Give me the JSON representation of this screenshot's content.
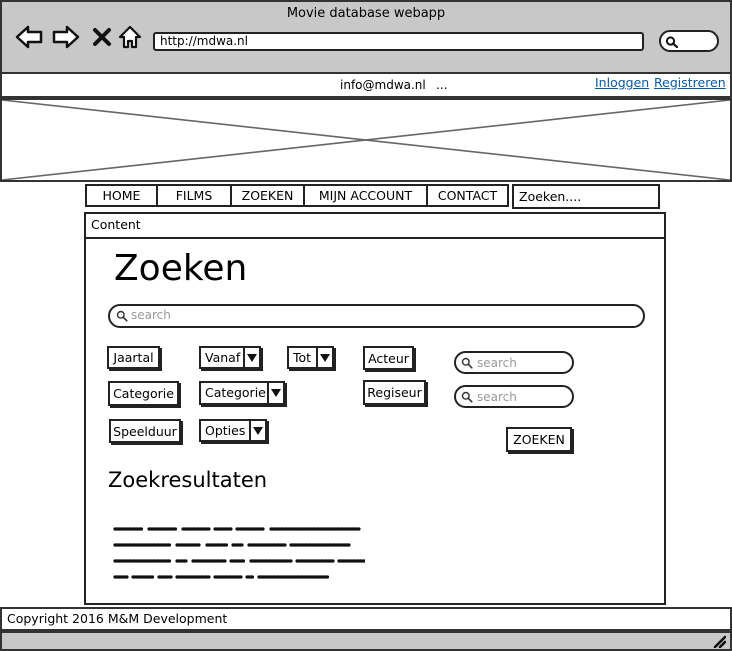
{
  "window": {
    "title": "Movie database webapp"
  },
  "browser": {
    "url": "http://mdwa.nl",
    "icons": [
      "back-arrow-icon",
      "forward-arrow-icon",
      "close-icon",
      "home-icon",
      "search-icon"
    ]
  },
  "topbar": {
    "email": "info@mdwa.nl",
    "dots": "...",
    "login_label": "Inloggen",
    "register_label": "Registreren",
    "link_color": "#0a5aa8"
  },
  "nav": {
    "items": [
      {
        "label": "HOME"
      },
      {
        "label": "FILMS"
      },
      {
        "label": "ZOEKEN"
      },
      {
        "label": "MIJN ACCOUNT"
      },
      {
        "label": "CONTACT"
      }
    ],
    "search_placeholder": "Zoeken...."
  },
  "content": {
    "label": "Content",
    "title": "Zoeken",
    "search_placeholder": "search",
    "filters": {
      "jaartal": "Jaartal",
      "vanaf": "Vanaf",
      "tot": "Tot",
      "acteur": "Acteur",
      "acteur_placeholder": "search",
      "categorie_button": "Categorie",
      "categorie_select": "Categorie",
      "regisseur": "Regiseur",
      "regisseur_placeholder": "search",
      "speelduur": "Speelduur",
      "opties": "Opties"
    },
    "submit_label": "ZOEKEN",
    "results_title": "Zoekresultaten"
  },
  "footer": {
    "text": "Copyright 2016 M&M Development"
  }
}
